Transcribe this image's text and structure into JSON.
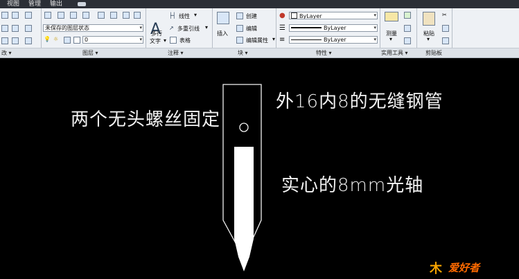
{
  "menu_tabs": [
    "视图",
    "管理",
    "输出"
  ],
  "layer": {
    "state": "未保存的图层状态",
    "current": "0",
    "panel_title": "图层 ▾"
  },
  "annotation": {
    "multiline_text": "多行",
    "text": "文字",
    "linear": "线性",
    "multileader": "多重引线",
    "table": "表格",
    "panel_title": "注释 ▾"
  },
  "block": {
    "insert": "插入",
    "create": "创建",
    "edit": "编辑",
    "edit_attributes": "编辑属性",
    "panel_title": "块 ▾"
  },
  "properties": {
    "color": "ByLayer",
    "lineweight": "ByLayer",
    "linetype": "ByLayer",
    "panel_title": "特性 ▾"
  },
  "utilities": {
    "measure": "测量",
    "panel_title": "实用工具 ▾"
  },
  "clipboard": {
    "paste": "粘贴",
    "panel_title": "剪贴板"
  },
  "draw_panel_title": "改 ▾",
  "canvas": {
    "label_screws": "两个无头螺丝固定",
    "label_tube": "外16内8的无缝钢管",
    "label_shaft": "实心的8mm光轴"
  },
  "watermark": {
    "text": "爱好者"
  }
}
